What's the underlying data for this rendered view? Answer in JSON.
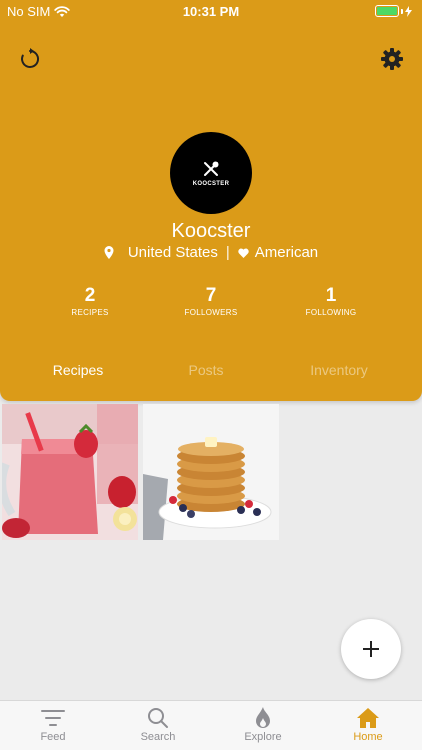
{
  "status": {
    "carrier": "No SIM",
    "time": "10:31 PM"
  },
  "profile": {
    "avatar_text": "KOOCSTER",
    "name": "Koocster",
    "location": "United States",
    "cuisine": "American"
  },
  "stats": [
    {
      "value": "2",
      "label": "RECIPES"
    },
    {
      "value": "7",
      "label": "FOLLOWERS"
    },
    {
      "value": "1",
      "label": "FOLLOWING"
    }
  ],
  "tabs": {
    "recipes": "Recipes",
    "posts": "Posts",
    "inventory": "Inventory",
    "active": "Recipes"
  },
  "tabbar": {
    "feed": "Feed",
    "search": "Search",
    "explore": "Explore",
    "home": "Home",
    "active": "Home"
  },
  "colors": {
    "accent": "#db9b18",
    "background": "#ebebeb"
  },
  "icons": [
    "refresh-icon",
    "gear-icon",
    "location-pin-icon",
    "heart-icon",
    "plus-icon",
    "filter-icon",
    "search-icon",
    "flame-icon",
    "home-icon"
  ]
}
